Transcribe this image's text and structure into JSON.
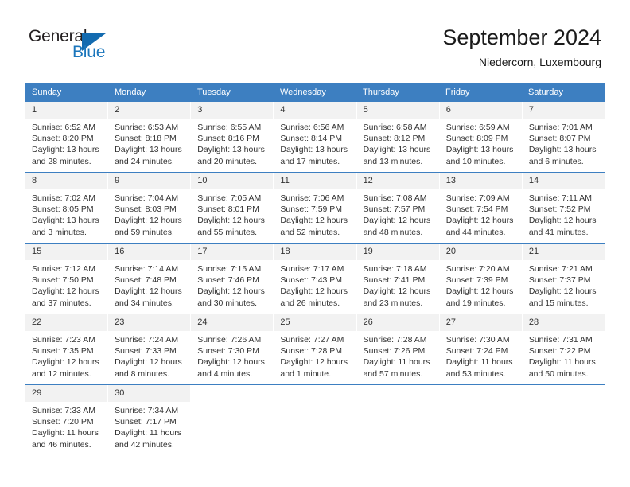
{
  "logo": {
    "word1": "General",
    "word2": "Blue",
    "triangle_color": "#136bb0",
    "blue_color": "#1b76bc"
  },
  "header": {
    "title": "September 2024",
    "location": "Niedercorn, Luxembourg"
  },
  "theme": {
    "header_row_bg": "#3d7fc1",
    "day_number_bg": "#f2f2f2",
    "text_color": "#333333"
  },
  "weekdays": [
    "Sunday",
    "Monday",
    "Tuesday",
    "Wednesday",
    "Thursday",
    "Friday",
    "Saturday"
  ],
  "weeks": [
    [
      {
        "day": "1",
        "sunrise": "Sunrise: 6:52 AM",
        "sunset": "Sunset: 8:20 PM",
        "daylight_line1": "Daylight: 13 hours",
        "daylight_line2": "and 28 minutes."
      },
      {
        "day": "2",
        "sunrise": "Sunrise: 6:53 AM",
        "sunset": "Sunset: 8:18 PM",
        "daylight_line1": "Daylight: 13 hours",
        "daylight_line2": "and 24 minutes."
      },
      {
        "day": "3",
        "sunrise": "Sunrise: 6:55 AM",
        "sunset": "Sunset: 8:16 PM",
        "daylight_line1": "Daylight: 13 hours",
        "daylight_line2": "and 20 minutes."
      },
      {
        "day": "4",
        "sunrise": "Sunrise: 6:56 AM",
        "sunset": "Sunset: 8:14 PM",
        "daylight_line1": "Daylight: 13 hours",
        "daylight_line2": "and 17 minutes."
      },
      {
        "day": "5",
        "sunrise": "Sunrise: 6:58 AM",
        "sunset": "Sunset: 8:12 PM",
        "daylight_line1": "Daylight: 13 hours",
        "daylight_line2": "and 13 minutes."
      },
      {
        "day": "6",
        "sunrise": "Sunrise: 6:59 AM",
        "sunset": "Sunset: 8:09 PM",
        "daylight_line1": "Daylight: 13 hours",
        "daylight_line2": "and 10 minutes."
      },
      {
        "day": "7",
        "sunrise": "Sunrise: 7:01 AM",
        "sunset": "Sunset: 8:07 PM",
        "daylight_line1": "Daylight: 13 hours",
        "daylight_line2": "and 6 minutes."
      }
    ],
    [
      {
        "day": "8",
        "sunrise": "Sunrise: 7:02 AM",
        "sunset": "Sunset: 8:05 PM",
        "daylight_line1": "Daylight: 13 hours",
        "daylight_line2": "and 3 minutes."
      },
      {
        "day": "9",
        "sunrise": "Sunrise: 7:04 AM",
        "sunset": "Sunset: 8:03 PM",
        "daylight_line1": "Daylight: 12 hours",
        "daylight_line2": "and 59 minutes."
      },
      {
        "day": "10",
        "sunrise": "Sunrise: 7:05 AM",
        "sunset": "Sunset: 8:01 PM",
        "daylight_line1": "Daylight: 12 hours",
        "daylight_line2": "and 55 minutes."
      },
      {
        "day": "11",
        "sunrise": "Sunrise: 7:06 AM",
        "sunset": "Sunset: 7:59 PM",
        "daylight_line1": "Daylight: 12 hours",
        "daylight_line2": "and 52 minutes."
      },
      {
        "day": "12",
        "sunrise": "Sunrise: 7:08 AM",
        "sunset": "Sunset: 7:57 PM",
        "daylight_line1": "Daylight: 12 hours",
        "daylight_line2": "and 48 minutes."
      },
      {
        "day": "13",
        "sunrise": "Sunrise: 7:09 AM",
        "sunset": "Sunset: 7:54 PM",
        "daylight_line1": "Daylight: 12 hours",
        "daylight_line2": "and 44 minutes."
      },
      {
        "day": "14",
        "sunrise": "Sunrise: 7:11 AM",
        "sunset": "Sunset: 7:52 PM",
        "daylight_line1": "Daylight: 12 hours",
        "daylight_line2": "and 41 minutes."
      }
    ],
    [
      {
        "day": "15",
        "sunrise": "Sunrise: 7:12 AM",
        "sunset": "Sunset: 7:50 PM",
        "daylight_line1": "Daylight: 12 hours",
        "daylight_line2": "and 37 minutes."
      },
      {
        "day": "16",
        "sunrise": "Sunrise: 7:14 AM",
        "sunset": "Sunset: 7:48 PM",
        "daylight_line1": "Daylight: 12 hours",
        "daylight_line2": "and 34 minutes."
      },
      {
        "day": "17",
        "sunrise": "Sunrise: 7:15 AM",
        "sunset": "Sunset: 7:46 PM",
        "daylight_line1": "Daylight: 12 hours",
        "daylight_line2": "and 30 minutes."
      },
      {
        "day": "18",
        "sunrise": "Sunrise: 7:17 AM",
        "sunset": "Sunset: 7:43 PM",
        "daylight_line1": "Daylight: 12 hours",
        "daylight_line2": "and 26 minutes."
      },
      {
        "day": "19",
        "sunrise": "Sunrise: 7:18 AM",
        "sunset": "Sunset: 7:41 PM",
        "daylight_line1": "Daylight: 12 hours",
        "daylight_line2": "and 23 minutes."
      },
      {
        "day": "20",
        "sunrise": "Sunrise: 7:20 AM",
        "sunset": "Sunset: 7:39 PM",
        "daylight_line1": "Daylight: 12 hours",
        "daylight_line2": "and 19 minutes."
      },
      {
        "day": "21",
        "sunrise": "Sunrise: 7:21 AM",
        "sunset": "Sunset: 7:37 PM",
        "daylight_line1": "Daylight: 12 hours",
        "daylight_line2": "and 15 minutes."
      }
    ],
    [
      {
        "day": "22",
        "sunrise": "Sunrise: 7:23 AM",
        "sunset": "Sunset: 7:35 PM",
        "daylight_line1": "Daylight: 12 hours",
        "daylight_line2": "and 12 minutes."
      },
      {
        "day": "23",
        "sunrise": "Sunrise: 7:24 AM",
        "sunset": "Sunset: 7:33 PM",
        "daylight_line1": "Daylight: 12 hours",
        "daylight_line2": "and 8 minutes."
      },
      {
        "day": "24",
        "sunrise": "Sunrise: 7:26 AM",
        "sunset": "Sunset: 7:30 PM",
        "daylight_line1": "Daylight: 12 hours",
        "daylight_line2": "and 4 minutes."
      },
      {
        "day": "25",
        "sunrise": "Sunrise: 7:27 AM",
        "sunset": "Sunset: 7:28 PM",
        "daylight_line1": "Daylight: 12 hours",
        "daylight_line2": "and 1 minute."
      },
      {
        "day": "26",
        "sunrise": "Sunrise: 7:28 AM",
        "sunset": "Sunset: 7:26 PM",
        "daylight_line1": "Daylight: 11 hours",
        "daylight_line2": "and 57 minutes."
      },
      {
        "day": "27",
        "sunrise": "Sunrise: 7:30 AM",
        "sunset": "Sunset: 7:24 PM",
        "daylight_line1": "Daylight: 11 hours",
        "daylight_line2": "and 53 minutes."
      },
      {
        "day": "28",
        "sunrise": "Sunrise: 7:31 AM",
        "sunset": "Sunset: 7:22 PM",
        "daylight_line1": "Daylight: 11 hours",
        "daylight_line2": "and 50 minutes."
      }
    ],
    [
      {
        "day": "29",
        "sunrise": "Sunrise: 7:33 AM",
        "sunset": "Sunset: 7:20 PM",
        "daylight_line1": "Daylight: 11 hours",
        "daylight_line2": "and 46 minutes."
      },
      {
        "day": "30",
        "sunrise": "Sunrise: 7:34 AM",
        "sunset": "Sunset: 7:17 PM",
        "daylight_line1": "Daylight: 11 hours",
        "daylight_line2": "and 42 minutes."
      },
      {
        "day": "",
        "sunrise": "",
        "sunset": "",
        "daylight_line1": "",
        "daylight_line2": ""
      },
      {
        "day": "",
        "sunrise": "",
        "sunset": "",
        "daylight_line1": "",
        "daylight_line2": ""
      },
      {
        "day": "",
        "sunrise": "",
        "sunset": "",
        "daylight_line1": "",
        "daylight_line2": ""
      },
      {
        "day": "",
        "sunrise": "",
        "sunset": "",
        "daylight_line1": "",
        "daylight_line2": ""
      },
      {
        "day": "",
        "sunrise": "",
        "sunset": "",
        "daylight_line1": "",
        "daylight_line2": ""
      }
    ]
  ]
}
